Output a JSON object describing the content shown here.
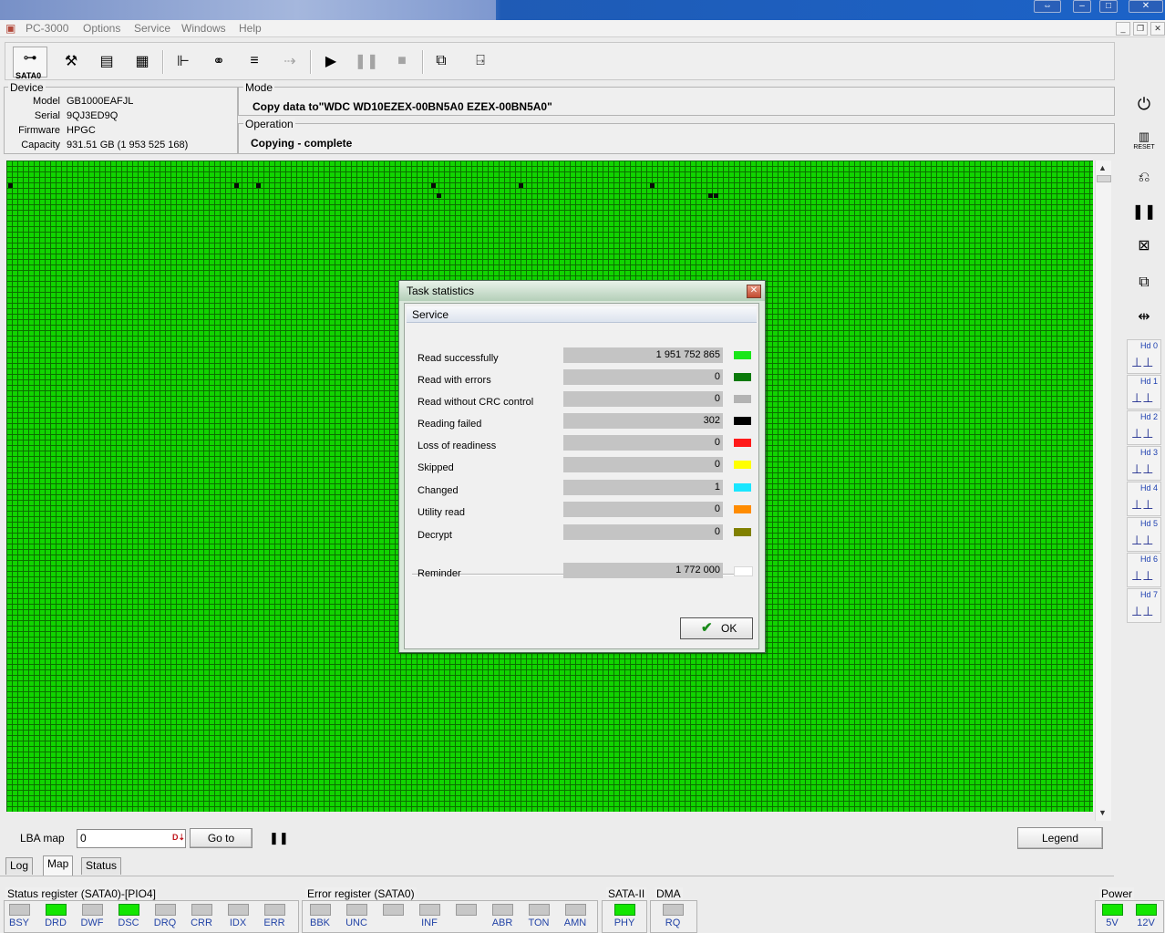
{
  "app": {
    "title": "PC-3000"
  },
  "menu": [
    "Options",
    "Service",
    "Windows",
    "Help"
  ],
  "toolbar": {
    "port_label": "SATA0"
  },
  "device": {
    "group_label": "Device",
    "fields": [
      {
        "key": "Model",
        "value": "GB1000EAFJL"
      },
      {
        "key": "Serial",
        "value": "9QJ3ED9Q"
      },
      {
        "key": "Firmware",
        "value": "HPGC"
      },
      {
        "key": "Capacity",
        "value": "931.51 GB (1 953 525 168)"
      }
    ]
  },
  "mode": {
    "group_label": "Mode",
    "text": "Copy data to\"WDC WD10EZEX-00BN5A0 EZEX-00BN5A0\""
  },
  "operation": {
    "group_label": "Operation",
    "text": "Copying - complete"
  },
  "map_controls": {
    "lba_label": "LBA map",
    "lba_value": "0",
    "goto_label": "Go to",
    "legend_label": "Legend"
  },
  "tabs": [
    {
      "label": "Log",
      "active": false
    },
    {
      "label": "Map",
      "active": true
    },
    {
      "label": "Status",
      "active": false
    }
  ],
  "registers": {
    "status": {
      "title": "Status register (SATA0)-[PIO4]",
      "leds": [
        {
          "name": "BSY",
          "on": false
        },
        {
          "name": "DRD",
          "on": true
        },
        {
          "name": "DWF",
          "on": false
        },
        {
          "name": "DSC",
          "on": true
        },
        {
          "name": "DRQ",
          "on": false
        },
        {
          "name": "CRR",
          "on": false
        },
        {
          "name": "IDX",
          "on": false
        },
        {
          "name": "ERR",
          "on": false
        }
      ]
    },
    "error": {
      "title": "Error register (SATA0)",
      "leds": [
        {
          "name": "BBK",
          "on": false
        },
        {
          "name": "UNC",
          "on": false
        },
        {
          "name": "",
          "on": false
        },
        {
          "name": "INF",
          "on": false
        },
        {
          "name": "",
          "on": false
        },
        {
          "name": "ABR",
          "on": false
        },
        {
          "name": "TON",
          "on": false
        },
        {
          "name": "AMN",
          "on": false
        }
      ]
    },
    "sata": {
      "title": "SATA-II",
      "leds": [
        {
          "name": "PHY",
          "on": true
        }
      ]
    },
    "dma": {
      "title": "DMA",
      "leds": [
        {
          "name": "RQ",
          "on": false
        }
      ]
    },
    "power": {
      "title": "Power",
      "leds": [
        {
          "name": "5V",
          "on": true
        },
        {
          "name": "12V",
          "on": true
        }
      ]
    }
  },
  "sidebar": {
    "hd_buttons": [
      "Hd 0",
      "Hd 1",
      "Hd 2",
      "Hd 3",
      "Hd 4",
      "Hd 5",
      "Hd 6",
      "Hd 7"
    ],
    "reset_label": "RESET"
  },
  "dialog": {
    "title": "Task statistics",
    "header": "Service",
    "rows": [
      {
        "label": "Read successfully",
        "value": "1 951 752 865",
        "color": "#19e619"
      },
      {
        "label": "Read with errors",
        "value": "0",
        "color": "#0b7a0b"
      },
      {
        "label": "Read without CRC control",
        "value": "0",
        "color": "#b3b3b3"
      },
      {
        "label": "Reading failed",
        "value": "302",
        "color": "#000000"
      },
      {
        "label": "Loss of readiness",
        "value": "0",
        "color": "#ff1a1a"
      },
      {
        "label": "Skipped",
        "value": "0",
        "color": "#ffff00"
      },
      {
        "label": "Changed",
        "value": "1",
        "color": "#1ae6ff"
      },
      {
        "label": "Utility read",
        "value": "0",
        "color": "#ff8c00"
      },
      {
        "label": "Decrypt",
        "value": "0",
        "color": "#808000"
      }
    ],
    "reminder": {
      "label": "Reminder",
      "value": "1 772 000",
      "color": "#ffffff"
    },
    "ok_label": "OK"
  }
}
